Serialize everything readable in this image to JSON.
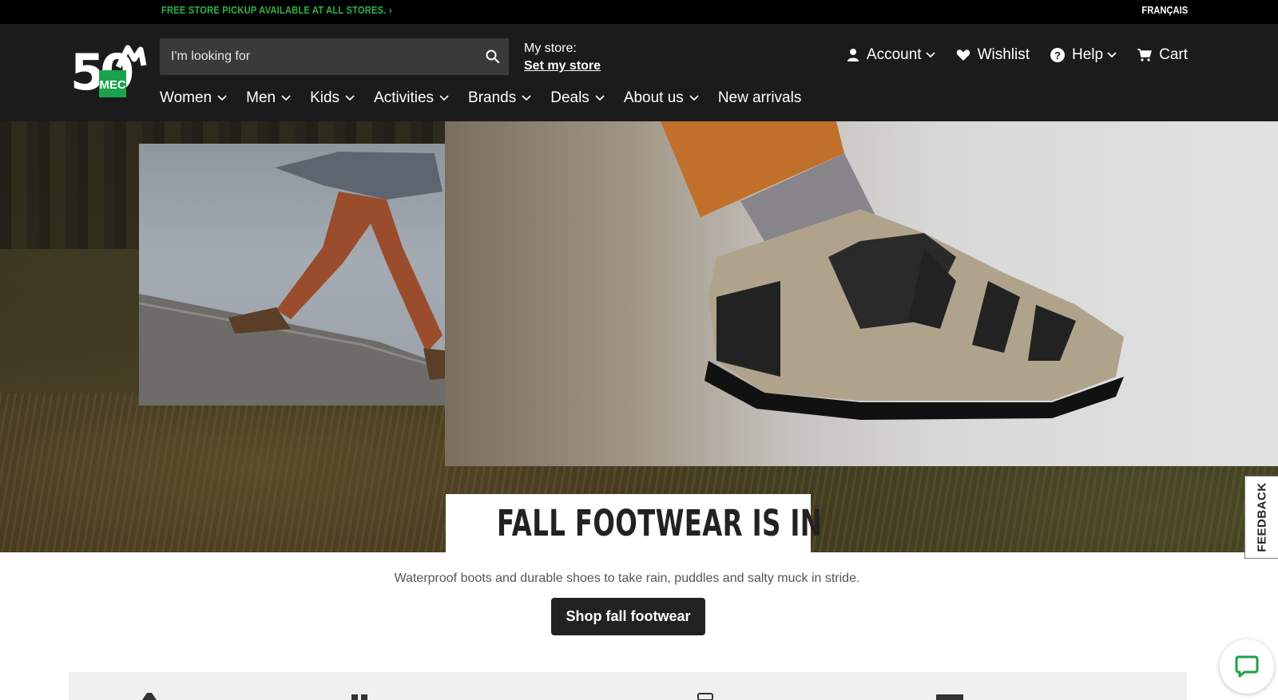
{
  "promo": {
    "text": "FREE STORE PICKUP AVAILABLE AT ALL STORES. ›"
  },
  "lang": {
    "label": "FRANÇAIS"
  },
  "logo": {
    "number": "50",
    "badge": "MEC",
    "brand_green": "#1aa34a"
  },
  "search": {
    "placeholder": "I'm looking for",
    "icon": "search-icon"
  },
  "store": {
    "label": "My store:",
    "link": "Set my store"
  },
  "util_nav": {
    "account": "Account",
    "wishlist": "Wishlist",
    "help": "Help",
    "cart": "Cart"
  },
  "main_nav": [
    {
      "label": "Women",
      "has_menu": true
    },
    {
      "label": "Men",
      "has_menu": true
    },
    {
      "label": "Kids",
      "has_menu": true
    },
    {
      "label": "Activities",
      "has_menu": true
    },
    {
      "label": "Brands",
      "has_menu": true
    },
    {
      "label": "Deals",
      "has_menu": true
    },
    {
      "label": "About us",
      "has_menu": true
    },
    {
      "label": "New arrivals",
      "has_menu": false
    }
  ],
  "hero": {
    "title": "FALL FOOTWEAR IS IN",
    "subtitle": "Waterproof boots and durable shoes to take rain, puddles and salty muck in stride.",
    "cta": "Shop fall footwear"
  },
  "feedback": {
    "label": "FEEDBACK"
  },
  "colors": {
    "promo_green": "#2cb04a",
    "header_bg": "#1b1b1b",
    "chat_green": "#1aa34a"
  }
}
